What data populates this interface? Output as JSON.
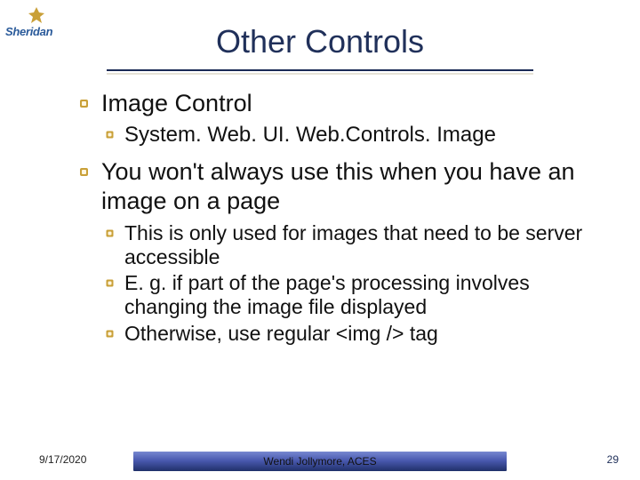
{
  "logo": {
    "text": "Sheridan"
  },
  "title": "Other Controls",
  "bullets": {
    "b1": "Image Control",
    "b1_1": "System. Web. UI. Web.Controls. Image",
    "b2": "You won't always use this when you have an image on a page",
    "b2_1": "This is only used for images that need to be server accessible",
    "b2_2": "E. g. if part of the page's processing involves changing the image file displayed",
    "b2_3": "Otherwise, use regular <img /> tag"
  },
  "footer": {
    "date": "9/17/2020",
    "author": "Wendi Jollymore, ACES",
    "page": "29"
  },
  "colors": {
    "title": "#20305a",
    "accent": "#c9a038",
    "bar_top": "#7788d0",
    "bar_bot": "#20306a"
  }
}
